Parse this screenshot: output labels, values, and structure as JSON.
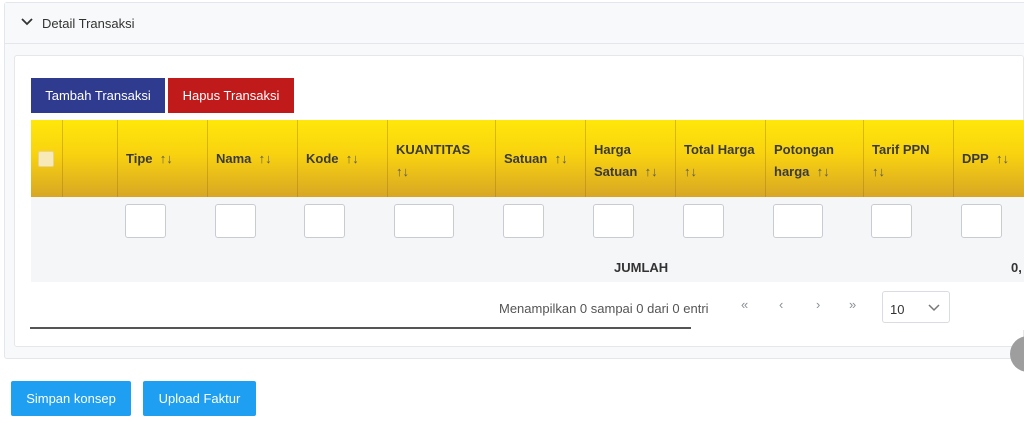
{
  "panel": {
    "title": "Detail Transaksi"
  },
  "toolbar": {
    "add_label": "Tambah Transaksi",
    "delete_label": "Hapus Transaksi"
  },
  "table": {
    "sort_glyph": "↑↓",
    "columns": [
      {
        "label": "Tipe"
      },
      {
        "label": "Nama"
      },
      {
        "label": "Kode"
      },
      {
        "label": "KUANTITAS"
      },
      {
        "label": "Satuan"
      },
      {
        "label": "Harga Satuan",
        "line1": "Harga",
        "line2": "Satuan"
      },
      {
        "label": "Total Harga"
      },
      {
        "label": "Potongan harga",
        "line1": "Potongan",
        "line2": "harga"
      },
      {
        "label": "Tarif PPN"
      },
      {
        "label": "DPP"
      }
    ],
    "totals": {
      "label": "JUMLAH",
      "value": "0,"
    }
  },
  "pagination": {
    "info": "Menampilkan 0 sampai 0 dari 0 entri",
    "first": "«",
    "prev": "‹",
    "next": "›",
    "last": "»",
    "page_size": "10"
  },
  "footer": {
    "save_label": "Simpan konsep",
    "upload_label": "Upload Faktur"
  },
  "colors": {
    "header_yellow": "#ffe70a",
    "add_blue": "#2f3b8f",
    "delete_red": "#c11a1a",
    "action_blue": "#1e9ff2"
  },
  "icons": {
    "collapse": "chevron-down-icon",
    "sort": "sort-icon",
    "select": "chevron-down-icon"
  }
}
